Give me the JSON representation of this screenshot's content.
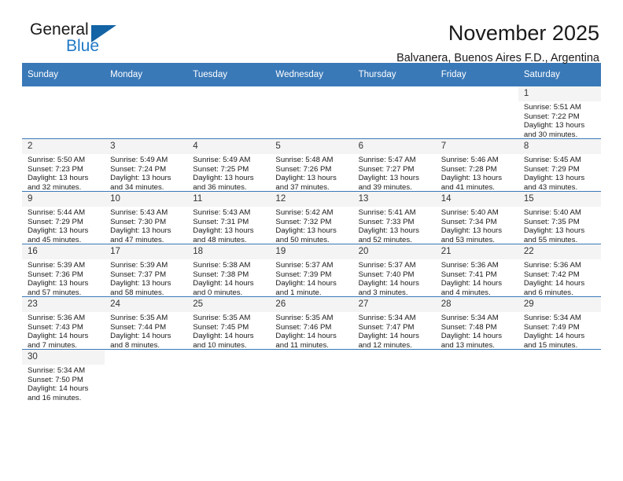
{
  "brand": {
    "name_top": "General",
    "name_bottom": "Blue",
    "triangle_icon": "triangle-logo-icon",
    "accent_color": "#2079c7",
    "header_color": "#3a79b8"
  },
  "header": {
    "title": "November 2025",
    "subtitle": "Balvanera, Buenos Aires F.D., Argentina"
  },
  "weekdays": [
    "Sunday",
    "Monday",
    "Tuesday",
    "Wednesday",
    "Thursday",
    "Friday",
    "Saturday"
  ],
  "labels": {
    "sunrise": "Sunrise:",
    "sunset": "Sunset:",
    "daylight": "Daylight:"
  },
  "weeks": [
    [
      {
        "empty": true
      },
      {
        "empty": true
      },
      {
        "empty": true
      },
      {
        "empty": true
      },
      {
        "empty": true
      },
      {
        "empty": true
      },
      {
        "day": "1",
        "sunrise": "Sunrise: 5:51 AM",
        "sunset": "Sunset: 7:22 PM",
        "daylight": "Daylight: 13 hours and 30 minutes."
      }
    ],
    [
      {
        "day": "2",
        "sunrise": "Sunrise: 5:50 AM",
        "sunset": "Sunset: 7:23 PM",
        "daylight": "Daylight: 13 hours and 32 minutes."
      },
      {
        "day": "3",
        "sunrise": "Sunrise: 5:49 AM",
        "sunset": "Sunset: 7:24 PM",
        "daylight": "Daylight: 13 hours and 34 minutes."
      },
      {
        "day": "4",
        "sunrise": "Sunrise: 5:49 AM",
        "sunset": "Sunset: 7:25 PM",
        "daylight": "Daylight: 13 hours and 36 minutes."
      },
      {
        "day": "5",
        "sunrise": "Sunrise: 5:48 AM",
        "sunset": "Sunset: 7:26 PM",
        "daylight": "Daylight: 13 hours and 37 minutes."
      },
      {
        "day": "6",
        "sunrise": "Sunrise: 5:47 AM",
        "sunset": "Sunset: 7:27 PM",
        "daylight": "Daylight: 13 hours and 39 minutes."
      },
      {
        "day": "7",
        "sunrise": "Sunrise: 5:46 AM",
        "sunset": "Sunset: 7:28 PM",
        "daylight": "Daylight: 13 hours and 41 minutes."
      },
      {
        "day": "8",
        "sunrise": "Sunrise: 5:45 AM",
        "sunset": "Sunset: 7:29 PM",
        "daylight": "Daylight: 13 hours and 43 minutes."
      }
    ],
    [
      {
        "day": "9",
        "sunrise": "Sunrise: 5:44 AM",
        "sunset": "Sunset: 7:29 PM",
        "daylight": "Daylight: 13 hours and 45 minutes."
      },
      {
        "day": "10",
        "sunrise": "Sunrise: 5:43 AM",
        "sunset": "Sunset: 7:30 PM",
        "daylight": "Daylight: 13 hours and 47 minutes."
      },
      {
        "day": "11",
        "sunrise": "Sunrise: 5:43 AM",
        "sunset": "Sunset: 7:31 PM",
        "daylight": "Daylight: 13 hours and 48 minutes."
      },
      {
        "day": "12",
        "sunrise": "Sunrise: 5:42 AM",
        "sunset": "Sunset: 7:32 PM",
        "daylight": "Daylight: 13 hours and 50 minutes."
      },
      {
        "day": "13",
        "sunrise": "Sunrise: 5:41 AM",
        "sunset": "Sunset: 7:33 PM",
        "daylight": "Daylight: 13 hours and 52 minutes."
      },
      {
        "day": "14",
        "sunrise": "Sunrise: 5:40 AM",
        "sunset": "Sunset: 7:34 PM",
        "daylight": "Daylight: 13 hours and 53 minutes."
      },
      {
        "day": "15",
        "sunrise": "Sunrise: 5:40 AM",
        "sunset": "Sunset: 7:35 PM",
        "daylight": "Daylight: 13 hours and 55 minutes."
      }
    ],
    [
      {
        "day": "16",
        "sunrise": "Sunrise: 5:39 AM",
        "sunset": "Sunset: 7:36 PM",
        "daylight": "Daylight: 13 hours and 57 minutes."
      },
      {
        "day": "17",
        "sunrise": "Sunrise: 5:39 AM",
        "sunset": "Sunset: 7:37 PM",
        "daylight": "Daylight: 13 hours and 58 minutes."
      },
      {
        "day": "18",
        "sunrise": "Sunrise: 5:38 AM",
        "sunset": "Sunset: 7:38 PM",
        "daylight": "Daylight: 14 hours and 0 minutes."
      },
      {
        "day": "19",
        "sunrise": "Sunrise: 5:37 AM",
        "sunset": "Sunset: 7:39 PM",
        "daylight": "Daylight: 14 hours and 1 minute."
      },
      {
        "day": "20",
        "sunrise": "Sunrise: 5:37 AM",
        "sunset": "Sunset: 7:40 PM",
        "daylight": "Daylight: 14 hours and 3 minutes."
      },
      {
        "day": "21",
        "sunrise": "Sunrise: 5:36 AM",
        "sunset": "Sunset: 7:41 PM",
        "daylight": "Daylight: 14 hours and 4 minutes."
      },
      {
        "day": "22",
        "sunrise": "Sunrise: 5:36 AM",
        "sunset": "Sunset: 7:42 PM",
        "daylight": "Daylight: 14 hours and 6 minutes."
      }
    ],
    [
      {
        "day": "23",
        "sunrise": "Sunrise: 5:36 AM",
        "sunset": "Sunset: 7:43 PM",
        "daylight": "Daylight: 14 hours and 7 minutes."
      },
      {
        "day": "24",
        "sunrise": "Sunrise: 5:35 AM",
        "sunset": "Sunset: 7:44 PM",
        "daylight": "Daylight: 14 hours and 8 minutes."
      },
      {
        "day": "25",
        "sunrise": "Sunrise: 5:35 AM",
        "sunset": "Sunset: 7:45 PM",
        "daylight": "Daylight: 14 hours and 10 minutes."
      },
      {
        "day": "26",
        "sunrise": "Sunrise: 5:35 AM",
        "sunset": "Sunset: 7:46 PM",
        "daylight": "Daylight: 14 hours and 11 minutes."
      },
      {
        "day": "27",
        "sunrise": "Sunrise: 5:34 AM",
        "sunset": "Sunset: 7:47 PM",
        "daylight": "Daylight: 14 hours and 12 minutes."
      },
      {
        "day": "28",
        "sunrise": "Sunrise: 5:34 AM",
        "sunset": "Sunset: 7:48 PM",
        "daylight": "Daylight: 14 hours and 13 minutes."
      },
      {
        "day": "29",
        "sunrise": "Sunrise: 5:34 AM",
        "sunset": "Sunset: 7:49 PM",
        "daylight": "Daylight: 14 hours and 15 minutes."
      }
    ],
    [
      {
        "day": "30",
        "sunrise": "Sunrise: 5:34 AM",
        "sunset": "Sunset: 7:50 PM",
        "daylight": "Daylight: 14 hours and 16 minutes."
      },
      {
        "blank": true
      },
      {
        "blank": true
      },
      {
        "blank": true
      },
      {
        "blank": true
      },
      {
        "blank": true
      },
      {
        "blank": true
      }
    ]
  ]
}
